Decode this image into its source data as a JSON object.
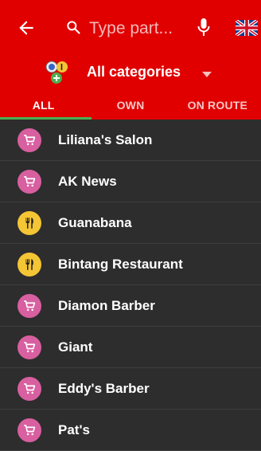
{
  "search": {
    "placeholder": "Type part..."
  },
  "category": {
    "label": "All categories"
  },
  "tabs": [
    {
      "label": "ALL",
      "active": true
    },
    {
      "label": "OWN",
      "active": false
    },
    {
      "label": "ON ROUTE",
      "active": false
    }
  ],
  "places": [
    {
      "name": "Liliana's Salon",
      "icon": "shopping-cart-icon"
    },
    {
      "name": "AK News",
      "icon": "shopping-cart-icon"
    },
    {
      "name": "Guanabana",
      "icon": "fork-knife-icon"
    },
    {
      "name": "Bintang Restaurant",
      "icon": "fork-knife-icon"
    },
    {
      "name": "Diamon Barber",
      "icon": "shopping-cart-icon"
    },
    {
      "name": "Giant",
      "icon": "shopping-cart-icon"
    },
    {
      "name": "Eddy's Barber",
      "icon": "shopping-cart-icon"
    },
    {
      "name": "Pat's",
      "icon": "shopping-cart-icon"
    }
  ],
  "colors": {
    "header": "#e00000",
    "tab_indicator": "#4caf50",
    "list_bg": "#2d2d2d",
    "shop_icon": "#d85fa0",
    "food_icon": "#f4c534"
  }
}
